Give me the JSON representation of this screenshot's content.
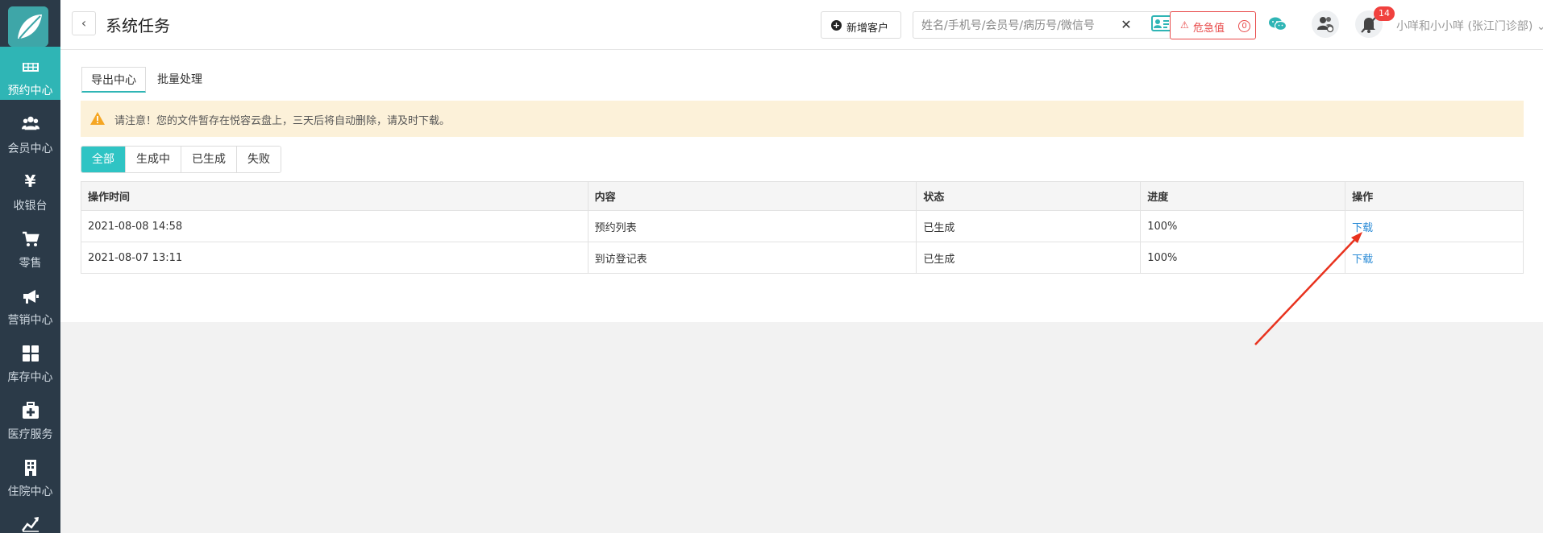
{
  "sidebar": {
    "items": [
      {
        "label": "预约中心",
        "icon": "calendar-icon",
        "active": true
      },
      {
        "label": "会员中心",
        "icon": "members-icon",
        "active": false
      },
      {
        "label": "收银台",
        "icon": "yen-icon",
        "active": false
      },
      {
        "label": "零售",
        "icon": "cart-icon",
        "active": false
      },
      {
        "label": "营销中心",
        "icon": "megaphone-icon",
        "active": false
      },
      {
        "label": "库存中心",
        "icon": "grid-icon",
        "active": false
      },
      {
        "label": "医疗服务",
        "icon": "medical-kit-icon",
        "active": false
      },
      {
        "label": "住院中心",
        "icon": "building-icon",
        "active": false
      },
      {
        "label": "",
        "icon": "trend-icon",
        "active": false
      }
    ]
  },
  "header": {
    "back": "‹",
    "title": "系统任务",
    "add_customer": "新增客户",
    "search_placeholder": "姓名/手机号/会员号/病历号/微信号",
    "search_clear": "✕",
    "danger_label": "危急值",
    "danger_count": "0",
    "notification_count": "14",
    "user": "小咩和小小咩 (张江门诊部) ⌄"
  },
  "tabs": [
    {
      "label": "导出中心",
      "active": true
    },
    {
      "label": "批量处理",
      "active": false
    }
  ],
  "notice": "请注意！您的文件暂存在悦容云盘上，三天后将自动删除，请及时下载。",
  "filters": [
    {
      "label": "全部",
      "active": true
    },
    {
      "label": "生成中",
      "active": false
    },
    {
      "label": "已生成",
      "active": false
    },
    {
      "label": "失败",
      "active": false
    }
  ],
  "table": {
    "headers": [
      "操作时间",
      "内容",
      "状态",
      "进度",
      "操作"
    ],
    "rows": [
      {
        "time": "2021-08-08 14:58",
        "content": "预约列表",
        "status": "已生成",
        "progress": "100%",
        "action": "下载"
      },
      {
        "time": "2021-08-07 13:11",
        "content": "到访登记表",
        "status": "已生成",
        "progress": "100%",
        "action": "下载"
      }
    ]
  },
  "colors": {
    "accent": "#2fb5b5",
    "sidebar_bg": "#2b3a48",
    "danger": "#e84a4a",
    "link": "#2a8bd6",
    "annotation_arrow": "#e8321e"
  }
}
